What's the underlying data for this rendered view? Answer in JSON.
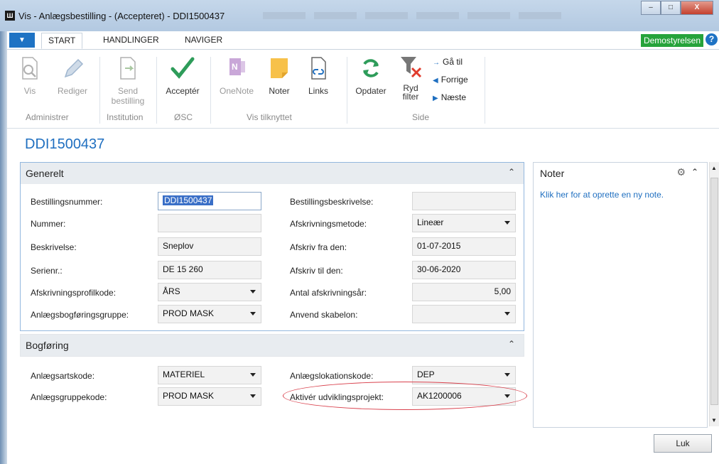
{
  "window": {
    "title": "Vis - Anlægsbestilling - (Accepteret) - DDI1500437",
    "app_icon": "dynamics-nav-icon",
    "controls": {
      "minimize": "–",
      "maximize": "□",
      "close": "X"
    }
  },
  "ribbon_tabs": [
    "START",
    "HANDLINGER",
    "NAVIGER"
  ],
  "company": "Demostyrelsen",
  "help": "?",
  "ribbon": {
    "buttons": {
      "vis": "Vis",
      "rediger": "Rediger",
      "send_bestilling_1": "Send",
      "send_bestilling_2": "bestilling",
      "accepter": "Acceptér",
      "onenote": "OneNote",
      "noter": "Noter",
      "links": "Links",
      "opdater": "Opdater",
      "ryd_filter_1": "Ryd",
      "ryd_filter_2": "filter"
    },
    "nav": {
      "ga_til": "Gå til",
      "forrige": "Forrige",
      "naeste": "Næste"
    },
    "groups": {
      "administrer": "Administrer",
      "institution": "Institution",
      "osc": "ØSC",
      "vis_tilknyttet": "Vis tilknyttet",
      "side": "Side"
    }
  },
  "page_title": "DDI1500437",
  "generelt": {
    "title": "Generelt",
    "fields": {
      "bestillingsnummer": {
        "label": "Bestillingsnummer:",
        "value": "DDI1500437"
      },
      "nummer": {
        "label": "Nummer:",
        "value": ""
      },
      "beskrivelse": {
        "label": "Beskrivelse:",
        "value": "Sneplov"
      },
      "serienr": {
        "label": "Serienr.:",
        "value": "DE 15 260"
      },
      "afskrivningsprofilkode": {
        "label": "Afskrivningsprofilkode:",
        "value": "ÅRS"
      },
      "anlaegsbogfoeringsgruppe": {
        "label": "Anlægsbogføringsgruppe:",
        "value": "PROD MASK"
      },
      "bestillingsbeskrivelse": {
        "label": "Bestillingsbeskrivelse:",
        "value": ""
      },
      "afskrivningsmetode": {
        "label": "Afskrivningsmetode:",
        "value": "Lineær"
      },
      "afskriv_fra": {
        "label": "Afskriv fra den:",
        "value": "01-07-2015"
      },
      "afskriv_til": {
        "label": "Afskriv til den:",
        "value": "30-06-2020"
      },
      "antal_aar": {
        "label": "Antal afskrivningsår:",
        "value": "5,00"
      },
      "anvend_skabelon": {
        "label": "Anvend skabelon:",
        "value": ""
      }
    }
  },
  "bogfoering": {
    "title": "Bogføring",
    "fields": {
      "anlaegsartskode": {
        "label": "Anlægsartskode:",
        "value": "MATERIEL"
      },
      "anlaegsgruppekode": {
        "label": "Anlægsgruppekode:",
        "value": "PROD MASK"
      },
      "anlaegslokationskode": {
        "label": "Anlægslokationskode:",
        "value": "DEP"
      },
      "aktiver_projekt": {
        "label": "Aktivér udviklingsprojekt:",
        "value": "AK1200006"
      }
    }
  },
  "noter": {
    "title": "Noter",
    "link": "Klik her for at oprette en ny note."
  },
  "close_button": "Luk"
}
